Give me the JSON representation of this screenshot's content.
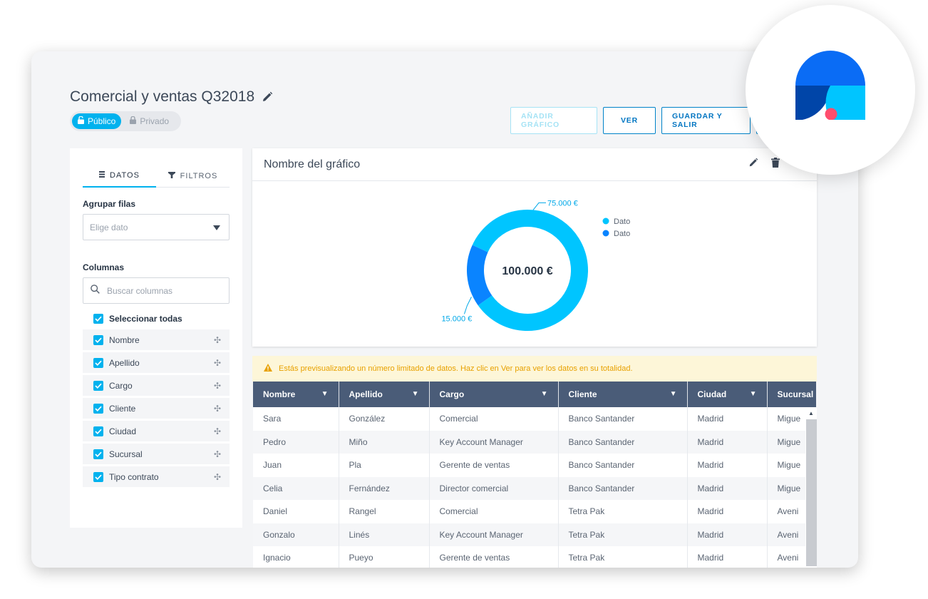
{
  "page": {
    "title": "Comercial y ventas Q32018",
    "visibility": {
      "public_label": "Público",
      "private_label": "Privado"
    }
  },
  "toolbar": {
    "add_chart_label": "AÑADIR GRÁFICO",
    "view_label": "VER",
    "save_exit_label": "GUARDAR Y SALIR"
  },
  "sidebar": {
    "tabs": [
      {
        "label": "DATOS"
      },
      {
        "label": "FILTROS"
      }
    ],
    "group_rows_label": "Agrupar filas",
    "group_rows_placeholder": "Elige dato",
    "columns_label": "Columnas",
    "search_placeholder": "Buscar columnas",
    "select_all_label": "Seleccionar todas",
    "columns": [
      {
        "label": "Nombre"
      },
      {
        "label": "Apellido"
      },
      {
        "label": "Cargo"
      },
      {
        "label": "Cliente"
      },
      {
        "label": "Ciudad"
      },
      {
        "label": "Sucursal"
      },
      {
        "label": "Tipo contrato"
      }
    ]
  },
  "chart": {
    "title": "Nombre del gráfico",
    "center_label": "100.000 €"
  },
  "chart_data": {
    "type": "pie",
    "center_text": "100.000 €",
    "series": [
      {
        "name": "Dato",
        "value": 75000,
        "data_label": "75.000 €",
        "color": "#00c5ff"
      },
      {
        "name": "Dato",
        "value": 15000,
        "data_label": "15.000 €",
        "color": "#0a84ff"
      }
    ],
    "legend_placement": "top-right",
    "label_color": "#00a8e8"
  },
  "warning": {
    "text": "Estás previsualizando un número limitado de datos. Haz clic en Ver para ver los datos en su totalidad."
  },
  "table": {
    "columns": [
      "Nombre",
      "Apellido",
      "Cargo",
      "Cliente",
      "Ciudad",
      "Sucursal"
    ],
    "rows": [
      [
        "Sara",
        "González",
        "Comercial",
        "Banco Santander",
        "Madrid",
        "Migue"
      ],
      [
        "Pedro",
        "Miño",
        "Key Account Manager",
        "Banco Santander",
        "Madrid",
        "Migue"
      ],
      [
        "Juan",
        "Pla",
        "Gerente de ventas",
        "Banco Santander",
        "Madrid",
        "Migue"
      ],
      [
        "Celia",
        "Fernández",
        "Director comercial",
        "Banco Santander",
        "Madrid",
        "Migue"
      ],
      [
        "Daniel",
        "Rangel",
        "Comercial",
        "Tetra Pak",
        "Madrid",
        "Aveni"
      ],
      [
        "Gonzalo",
        "Linés",
        "Key Account Manager",
        "Tetra Pak",
        "Madrid",
        "Aveni"
      ],
      [
        "Ignacio",
        "Pueyo",
        "Gerente de ventas",
        "Tetra Pak",
        "Madrid",
        "Aveni"
      ]
    ]
  },
  "colors": {
    "accent": "#00b2ee",
    "primary_button": "#0083c9",
    "table_header": "#4a5c78",
    "warning_bg": "#fdf6d8",
    "warning_text": "#e8a100"
  },
  "icons": {
    "title_edit": "pencil-icon",
    "public": "unlock-icon",
    "private": "lock-icon",
    "datos_tab": "list-icon",
    "filtros_tab": "filter-icon",
    "dropdown": "caret-down-icon",
    "search": "search-icon",
    "checkbox": "check-icon",
    "drag": "move-icon",
    "chart_edit": "pencil-icon",
    "chart_delete": "trash-icon",
    "warning": "warning-icon",
    "logo": "brand-logo-icon"
  }
}
